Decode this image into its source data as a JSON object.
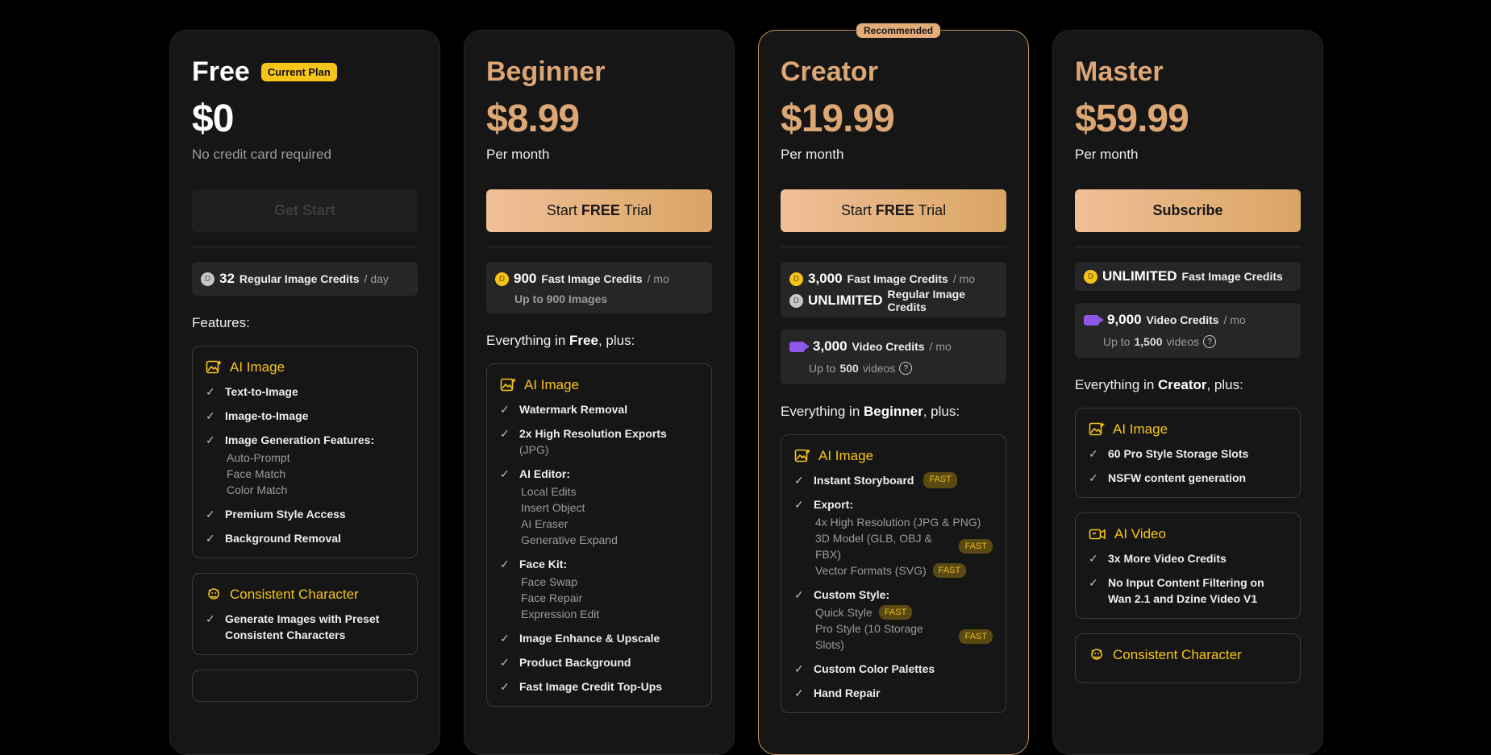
{
  "recommended_badge": "Recommended",
  "plans": {
    "free": {
      "name": "Free",
      "current_badge": "Current Plan",
      "price": "$0",
      "note": "No credit card required",
      "cta": "Get Start",
      "credit1": {
        "num": "32",
        "label": "Regular Image Credits",
        "per": "/ day"
      },
      "features_head": "Features:",
      "ai_image": {
        "title": "AI Image",
        "items": [
          "Text-to-Image",
          "Image-to-Image",
          "Image Generation Features:",
          "Premium Style Access",
          "Background Removal"
        ],
        "gen_sub": [
          "Auto-Prompt",
          "Face Match",
          "Color Match"
        ]
      },
      "consistent": {
        "title": "Consistent Character",
        "item": "Generate Images with Preset Consistent Characters"
      }
    },
    "beginner": {
      "name": "Beginner",
      "price": "$8.99",
      "note": "Per month",
      "cta_a": "Start",
      "cta_b": "FREE",
      "cta_c": "Trial",
      "credit1": {
        "num": "900",
        "label": "Fast Image Credits",
        "per": "/ mo",
        "sub": "Up to 900 Images"
      },
      "everything_a": "Everything in",
      "everything_b": "Free",
      "everything_c": ", plus:",
      "ai_image": {
        "title": "AI Image",
        "i1": "Watermark Removal",
        "i2": "2x High Resolution Exports",
        "i2b": "(JPG)",
        "i3": "AI Editor:",
        "editor_sub": [
          "Local Edits",
          "Insert Object",
          "AI Eraser",
          "Generative Expand"
        ],
        "i4": "Face Kit:",
        "face_sub": [
          "Face Swap",
          "Face Repair",
          "Expression Edit"
        ],
        "i5": "Image Enhance & Upscale",
        "i6": "Product Background",
        "i7": "Fast Image Credit Top-Ups"
      }
    },
    "creator": {
      "name": "Creator",
      "price": "$19.99",
      "note": "Per month",
      "cta_a": "Start",
      "cta_b": "FREE",
      "cta_c": "Trial",
      "credit1": {
        "num": "3,000",
        "label": "Fast Image Credits",
        "per": "/ mo"
      },
      "credit2": {
        "num": "UNLIMITED",
        "label": "Regular Image Credits"
      },
      "video": {
        "num": "3,000",
        "label": "Video Credits",
        "per": "/ mo",
        "sub_a": "Up to",
        "sub_b": "500",
        "sub_c": "videos"
      },
      "everything_a": "Everything in",
      "everything_b": "Beginner",
      "everything_c": ", plus:",
      "ai_image": {
        "title": "AI Image",
        "i1": "Instant Storyboard",
        "i2": "Export:",
        "export_sub": [
          "4x High Resolution (JPG & PNG)",
          "3D Model (GLB, OBJ & FBX)",
          "Vector Formats (SVG)"
        ],
        "i3": "Custom Style:",
        "style_sub": [
          "Quick Style",
          "Pro Style (10 Storage Slots)"
        ],
        "i4": "Custom Color Palettes",
        "i5": "Hand Repair"
      },
      "fast": "FAST"
    },
    "master": {
      "name": "Master",
      "price": "$59.99",
      "note": "Per month",
      "cta": "Subscribe",
      "credit1": {
        "num": "UNLIMITED",
        "label": "Fast Image Credits"
      },
      "video": {
        "num": "9,000",
        "label": "Video Credits",
        "per": "/ mo",
        "sub_a": "Up to",
        "sub_b": "1,500",
        "sub_c": "videos"
      },
      "everything_a": "Everything in",
      "everything_b": "Creator",
      "everything_c": ", plus:",
      "ai_image": {
        "title": "AI Image",
        "i1": "60 Pro Style Storage Slots",
        "i2": "NSFW content generation"
      },
      "ai_video": {
        "title": "AI Video",
        "i1": "3x More Video Credits",
        "i2": "No Input Content Filtering on Wan 2.1 and Dzine Video V1"
      },
      "consistent": {
        "title": "Consistent Character"
      }
    }
  },
  "colors": {
    "accent_gold": "#dca675",
    "feature_yellow": "#f7c519",
    "video_purple": "#8d57e8",
    "recommended_border": "#c9985f"
  },
  "icons": {
    "ai_image": "image-sparkle-icon",
    "ai_video": "video-sparkle-icon",
    "consistent": "character-icon",
    "check": "check-icon",
    "coin": "coin-icon",
    "help": "help-icon"
  }
}
